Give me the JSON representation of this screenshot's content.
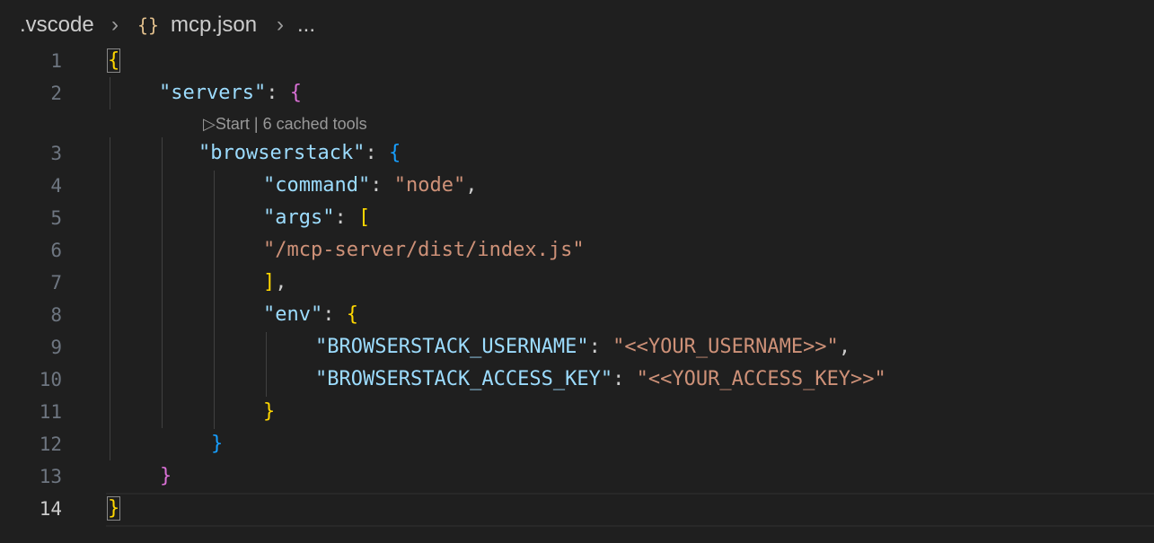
{
  "breadcrumb": {
    "folder": ".vscode",
    "file_icon": "braces-icon",
    "file": "mcp.json",
    "more": "..."
  },
  "codelens": {
    "start": "Start",
    "separator": "|",
    "tools": "6 cached tools"
  },
  "lines": [
    {
      "num": "1"
    },
    {
      "num": "2"
    },
    {
      "num": "3"
    },
    {
      "num": "4"
    },
    {
      "num": "5"
    },
    {
      "num": "6"
    },
    {
      "num": "7"
    },
    {
      "num": "8"
    },
    {
      "num": "9"
    },
    {
      "num": "10"
    },
    {
      "num": "11"
    },
    {
      "num": "12"
    },
    {
      "num": "13"
    },
    {
      "num": "14"
    }
  ],
  "code": {
    "l1_brace": "{",
    "l2_key": "\"servers\"",
    "l2_colon": ": ",
    "l2_brace": "{",
    "l3_key": "\"browserstack\"",
    "l3_colon": ": ",
    "l3_brace": "{",
    "l4_key": "\"command\"",
    "l4_colon": ": ",
    "l4_val": "\"node\"",
    "l4_comma": ",",
    "l5_key": "\"args\"",
    "l5_colon": ": ",
    "l5_bracket": "[",
    "l6_val": "\"/mcp-server/dist/index.js\"",
    "l7_bracket": "]",
    "l7_comma": ",",
    "l8_key": "\"env\"",
    "l8_colon": ": ",
    "l8_brace": "{",
    "l9_key": "\"BROWSERSTACK_USERNAME\"",
    "l9_colon": ": ",
    "l9_val": "\"<<YOUR_USERNAME>>\"",
    "l9_comma": ",",
    "l10_key": "\"BROWSERSTACK_ACCESS_KEY\"",
    "l10_colon": ": ",
    "l10_val": "\"<<YOUR_ACCESS_KEY>>\"",
    "l11_brace": "}",
    "l12_brace": "}",
    "l13_brace": "}",
    "l14_brace": "}"
  },
  "colors": {
    "background": "#1f1f1f",
    "key": "#9cdcfe",
    "string": "#ce9178",
    "bracket_level1": "#ffd700",
    "bracket_level2": "#da70d6",
    "bracket_level3": "#179fff"
  }
}
